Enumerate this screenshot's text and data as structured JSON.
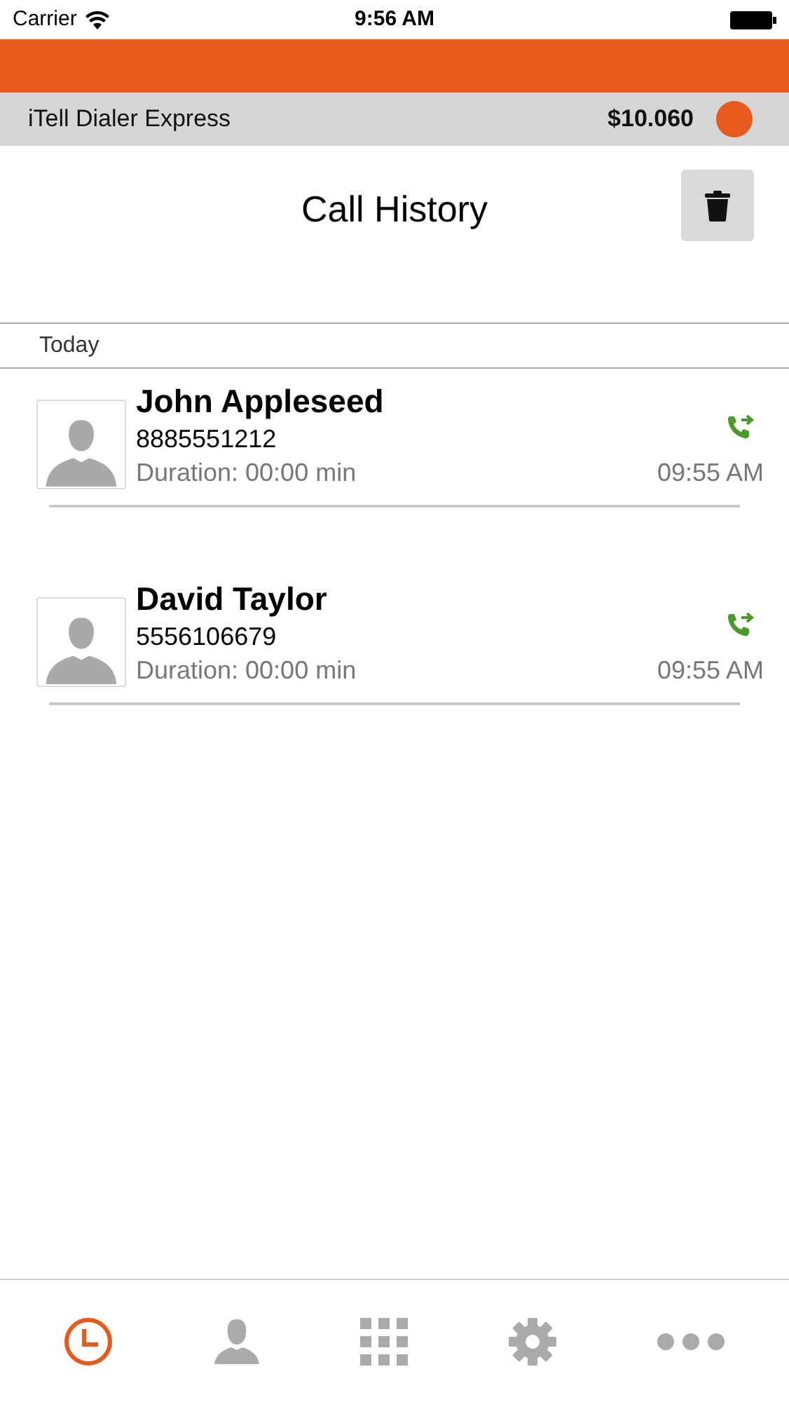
{
  "status_bar": {
    "carrier": "Carrier",
    "time": "9:56 AM"
  },
  "account_bar": {
    "app_name": "iTell Dialer Express",
    "balance": "$10.060"
  },
  "header": {
    "title": "Call History"
  },
  "sections": [
    {
      "label": "Today",
      "calls": [
        {
          "name": "John Appleseed",
          "number": "8885551212",
          "duration": "Duration: 00:00 min",
          "time": "09:55 AM",
          "kind": "outgoing"
        },
        {
          "name": "David Taylor",
          "number": "5556106679",
          "duration": "Duration: 00:00 min",
          "time": "09:55 AM",
          "kind": "outgoing"
        }
      ]
    }
  ],
  "tab_bar": [
    {
      "kind": "clock",
      "selected": true
    },
    {
      "kind": "person",
      "selected": false
    },
    {
      "kind": "keypad",
      "selected": false
    },
    {
      "kind": "gear",
      "selected": false
    },
    {
      "kind": "more",
      "selected": false
    }
  ]
}
